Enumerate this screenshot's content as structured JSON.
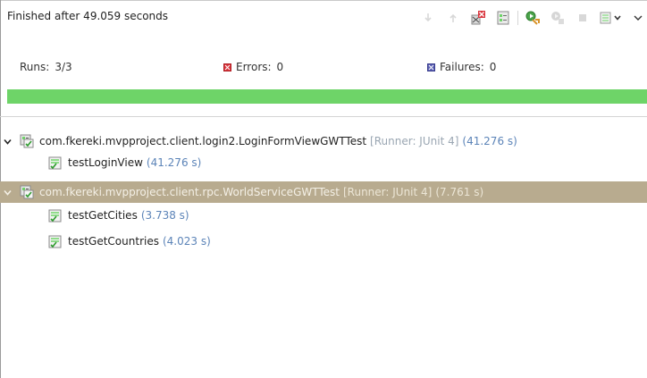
{
  "status": {
    "text": "Finished after 49.059 seconds"
  },
  "toolbar": {
    "buttons": [
      {
        "icon": "next-failure-icon"
      },
      {
        "icon": "previous-failure-icon"
      },
      {
        "icon": "show-failures-only-icon"
      },
      {
        "icon": "scroll-lock-icon"
      },
      {
        "icon": "rerun-test-icon"
      },
      {
        "icon": "rerun-failed-first-icon"
      },
      {
        "icon": "stop-icon"
      },
      {
        "icon": "test-run-history-icon"
      },
      {
        "icon": "view-menu-icon"
      }
    ]
  },
  "counters": {
    "runs_label": "Runs:",
    "runs_value": "3/3",
    "errors_label": "Errors:",
    "errors_value": "0",
    "failures_label": "Failures:",
    "failures_value": "0"
  },
  "progress": {
    "fraction": 1.0,
    "color": "#6ed468"
  },
  "tree": {
    "suites": [
      {
        "name": "com.fkereki.mvpproject.client.login2.LoginFormViewGWTTest",
        "runner": "[Runner: JUnit 4]",
        "time": "(41.276 s)",
        "selected": false,
        "tests": [
          {
            "name": "testLoginView",
            "time": "(41.276 s)"
          }
        ]
      },
      {
        "name": "com.fkereki.mvpproject.client.rpc.WorldServiceGWTTest",
        "runner": "[Runner: JUnit 4]",
        "time": "(7.761 s)",
        "selected": true,
        "tests": [
          {
            "name": "testGetCities",
            "time": "(3.738 s)"
          },
          {
            "name": "testGetCountries",
            "time": "(4.023 s)"
          }
        ]
      }
    ]
  },
  "colors": {
    "pass_green": "#6ed468",
    "selection": "#b8ab8f",
    "time_blue": "#5c84b8",
    "error_red": "#d9363e",
    "failure_blue": "#5a5fb2"
  }
}
